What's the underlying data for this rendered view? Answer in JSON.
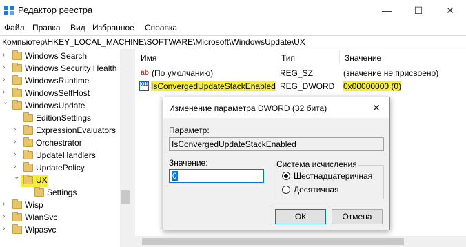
{
  "window": {
    "title": "Редактор реестра",
    "min_glyph": "—",
    "max_glyph": "☐",
    "close_glyph": "✕"
  },
  "menu": {
    "items": [
      "Файл",
      "Правка",
      "Вид",
      "Избранное",
      "Справка"
    ]
  },
  "address": {
    "path": "Компьютер\\HKEY_LOCAL_MACHINE\\SOFTWARE\\Microsoft\\WindowsUpdate\\UX"
  },
  "tree": {
    "items": [
      {
        "label": "Windows Search",
        "expander": "›"
      },
      {
        "label": "Windows Security Health",
        "expander": "›"
      },
      {
        "label": "WindowsRuntime",
        "expander": "›"
      },
      {
        "label": "WindowsSelfHost",
        "expander": "›"
      },
      {
        "label": "WindowsUpdate",
        "expander": "⌄"
      },
      {
        "label": "EditionSettings",
        "expander": ""
      },
      {
        "label": "ExpressionEvaluators",
        "expander": "›"
      },
      {
        "label": "Orchestrator",
        "expander": "›"
      },
      {
        "label": "UpdateHandlers",
        "expander": "›"
      },
      {
        "label": "UpdatePolicy",
        "expander": "›"
      },
      {
        "label": "UX",
        "expander": "⌄"
      },
      {
        "label": "Settings",
        "expander": ""
      },
      {
        "label": "Wisp",
        "expander": "›"
      },
      {
        "label": "WlanSvc",
        "expander": "›"
      },
      {
        "label": "Wlpasvc",
        "expander": "›"
      }
    ]
  },
  "values": {
    "headers": {
      "name": "Имя",
      "type": "Тип",
      "data": "Значение"
    },
    "rows": [
      {
        "icon": "ab",
        "name": "(По умолчанию)",
        "type": "REG_SZ",
        "data": "(значение не присвоено)"
      },
      {
        "icon": "011",
        "name": "IsConvergedUpdateStackEnabled",
        "type": "REG_DWORD",
        "data": "0x00000000 (0)"
      }
    ]
  },
  "dialog": {
    "title": "Изменение параметра DWORD (32 бита)",
    "close_glyph": "✕",
    "param_label": "Параметр:",
    "param_value": "IsConvergedUpdateStackEnabled",
    "value_label": "Значение:",
    "value": "0",
    "base_label": "Система исчисления",
    "radio_hex": "Шестнадцатеричная",
    "radio_dec": "Десятичная",
    "ok": "ОК",
    "cancel": "Отмена"
  },
  "colors": {
    "highlight": "#f4ee3a",
    "accent": "#0078d7",
    "folder": "#e9c46a"
  }
}
